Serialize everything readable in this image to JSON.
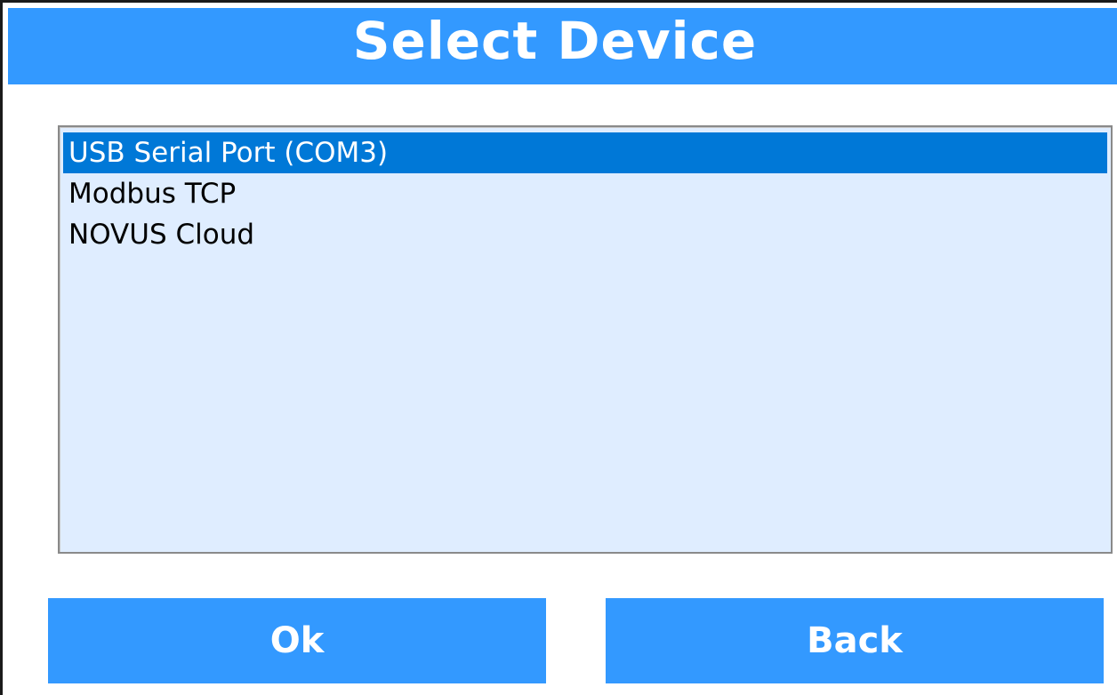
{
  "dialog": {
    "title": "Select Device"
  },
  "device_list": {
    "items": [
      {
        "label": "USB Serial Port (COM3)",
        "selected": true
      },
      {
        "label": "Modbus TCP",
        "selected": false
      },
      {
        "label": "NOVUS Cloud",
        "selected": false
      }
    ]
  },
  "buttons": {
    "ok_label": "Ok",
    "back_label": "Back"
  },
  "colors": {
    "header": "#3399ff",
    "list_background": "#dfedff",
    "selection": "#0078d7",
    "button": "#3399ff",
    "button_text": "#ffffff"
  }
}
